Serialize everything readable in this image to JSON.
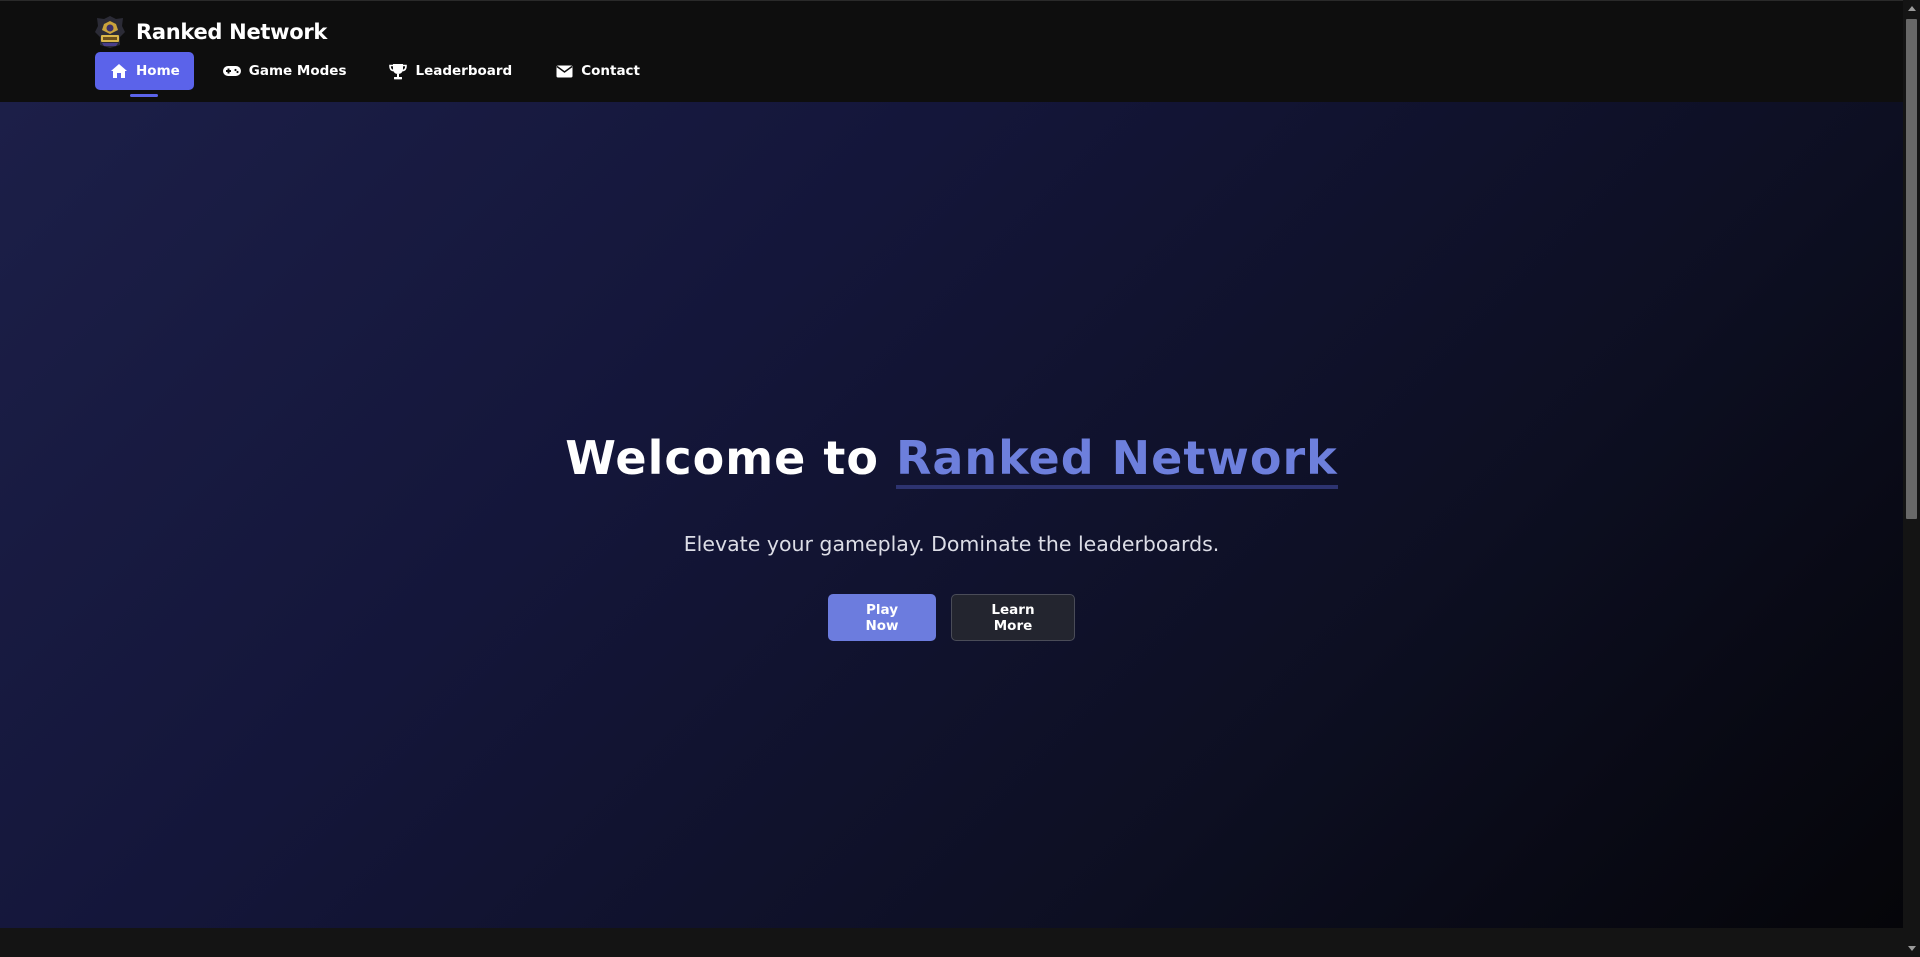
{
  "brand": {
    "name": "Ranked Network",
    "logo_icon": "ranked-network-logo"
  },
  "nav": {
    "items": [
      {
        "label": "Home",
        "icon": "home-icon",
        "active": true
      },
      {
        "label": "Game Modes",
        "icon": "gamepad-icon",
        "active": false
      },
      {
        "label": "Leaderboard",
        "icon": "trophy-icon",
        "active": false
      },
      {
        "label": "Contact",
        "icon": "envelope-icon",
        "active": false
      }
    ]
  },
  "hero": {
    "title_prefix": "Welcome to",
    "title_accent": "Ranked Network",
    "subtitle": "Elevate your gameplay. Dominate the leaderboards.",
    "primary_button": "Play Now",
    "secondary_button": "Learn More"
  },
  "colors": {
    "accent": "#5b63ea",
    "accent_text": "#6d7fdc",
    "primary_button": "#6c7cde",
    "header_bg": "#0e0e0e",
    "hero_gradient_start": "#1c1f48",
    "hero_gradient_end": "#050509"
  }
}
